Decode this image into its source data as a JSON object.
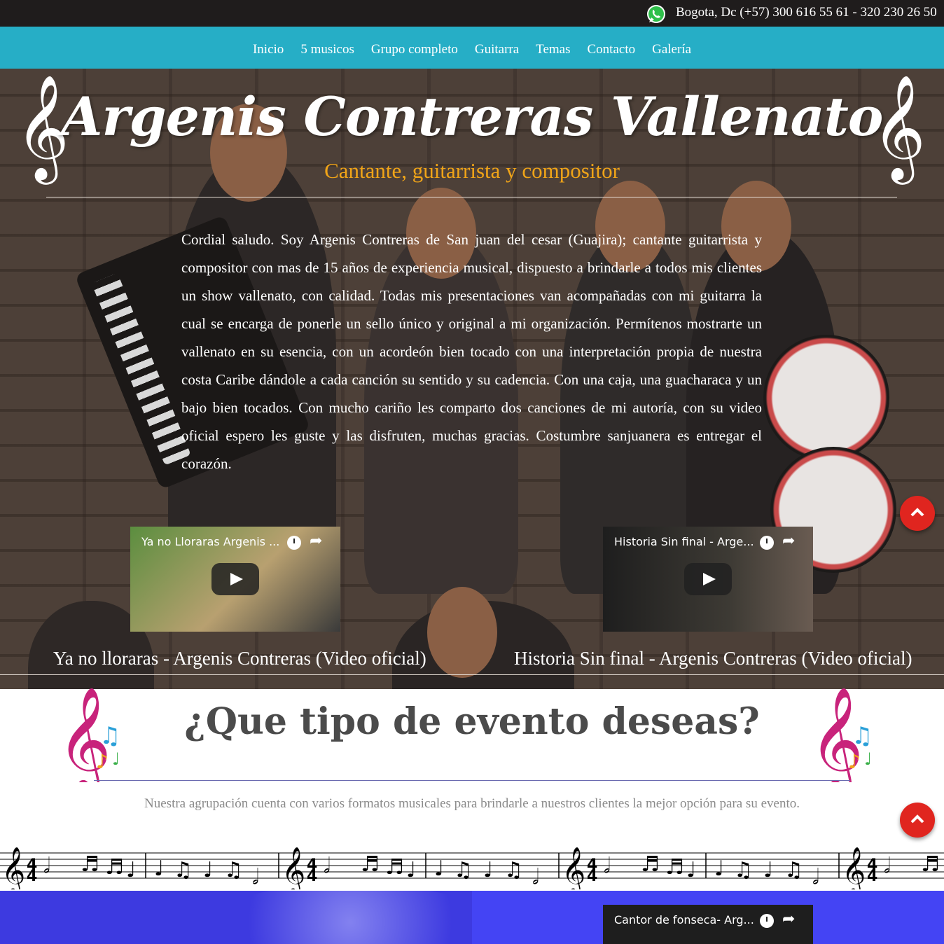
{
  "topbar": {
    "icon": "whatsapp-icon",
    "contact": "Bogota, Dc (+57) 300 616 55 61 - 320 230 26 50"
  },
  "nav": {
    "items": [
      "Inicio",
      "5 musicos",
      "Grupo completo",
      "Guitarra",
      "Temas",
      "Contacto",
      "Galería"
    ]
  },
  "hero": {
    "title": "Argenis Contreras Vallenato",
    "subtitle": "Cantante, guitarrista y compositor",
    "intro": "Cordial saludo. Soy Argenis Contreras de San juan del cesar (Guajira); cantante guitarrista y compositor con mas de 15 años de experiencia musical, dispuesto a brindarle a todos mis clientes un show vallenato, con calidad. Todas mis presentaciones van acompañadas con mi guitarra la cual se encarga de ponerle un sello único y original a mi organización. Permítenos mostrarte un vallenato en su esencia, con un acordeón bien tocado con una interpretación propia de nuestra costa Caribe dándole a cada canción su sentido y su cadencia. Con una caja, una guacharaca y un bajo bien tocados. Con mucho cariño les comparto dos canciones de mi autoría, con su video oficial espero les guste y las disfruten, muchas gracias. Costumbre sanjuanera es entregar el corazón.",
    "videos": [
      {
        "title": "Ya no Lloraras Argenis ...",
        "caption": "Ya no lloraras - Argenis Contreras (Video oficial)"
      },
      {
        "title": "Historia Sin final - Arge...",
        "caption": "Historia Sin final - Argenis Contreras (Video oficial)"
      }
    ]
  },
  "event": {
    "title": "¿Que tipo de evento deseas?",
    "description": "Nuestra agrupación cuenta con varios formatos musicales para brindarle a nuestros clientes la mejor opción para su evento."
  },
  "bottom": {
    "video_title": "Cantor de fonseca- Arg..."
  },
  "colors": {
    "nav": "#26aec6",
    "subtitle": "#f0a418",
    "scroll_top": "#e0251f",
    "panel": "#4444f4"
  }
}
